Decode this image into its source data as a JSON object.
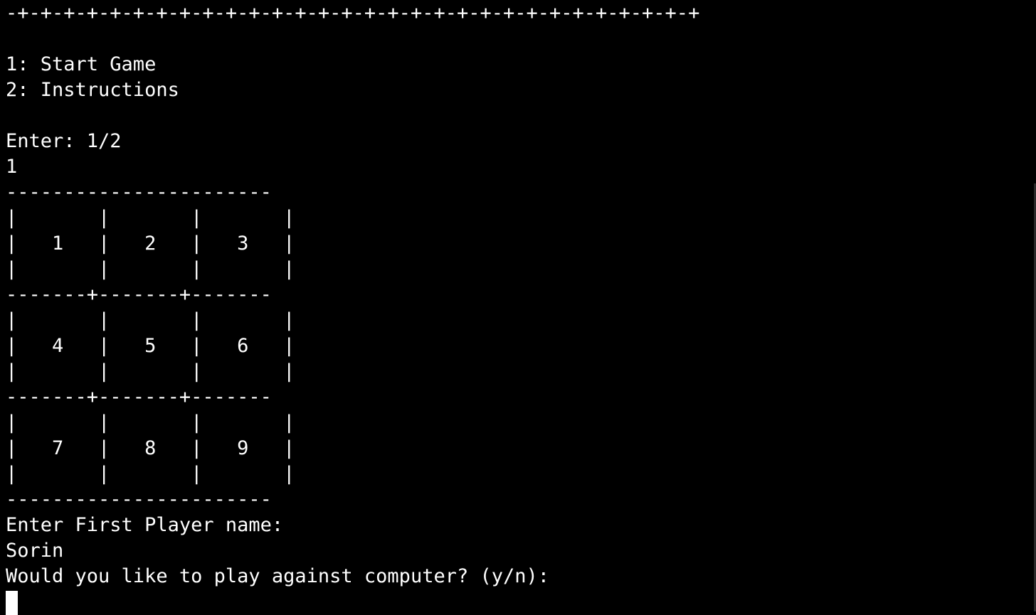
{
  "colors": {
    "background": "#000000",
    "text": "#ffffff"
  },
  "banner": "-+-+-+-+-+-+-+-+-+-+-+-+-+-+-+-+-+-+-+-+-+-+-+-+-+-+-+-+-+-+",
  "menu": {
    "options": [
      "1: Start Game",
      "2: Instructions"
    ],
    "prompt": "Enter: 1/2",
    "input": "1"
  },
  "board": {
    "border_top": "-----------------------",
    "row_separator": "-------+-------+-------",
    "border_bottom": "-----------------------",
    "blank_row": "|       |       |       |",
    "cell_rows": [
      "|   1   |   2   |   3   |",
      "|   4   |   5   |   6   |",
      "|   7   |   8   |   9   |"
    ]
  },
  "player": {
    "name_prompt": "Enter First Player name:",
    "name_input": "Sorin"
  },
  "opponent_prompt": "Would you like to play against computer? (y/n):"
}
